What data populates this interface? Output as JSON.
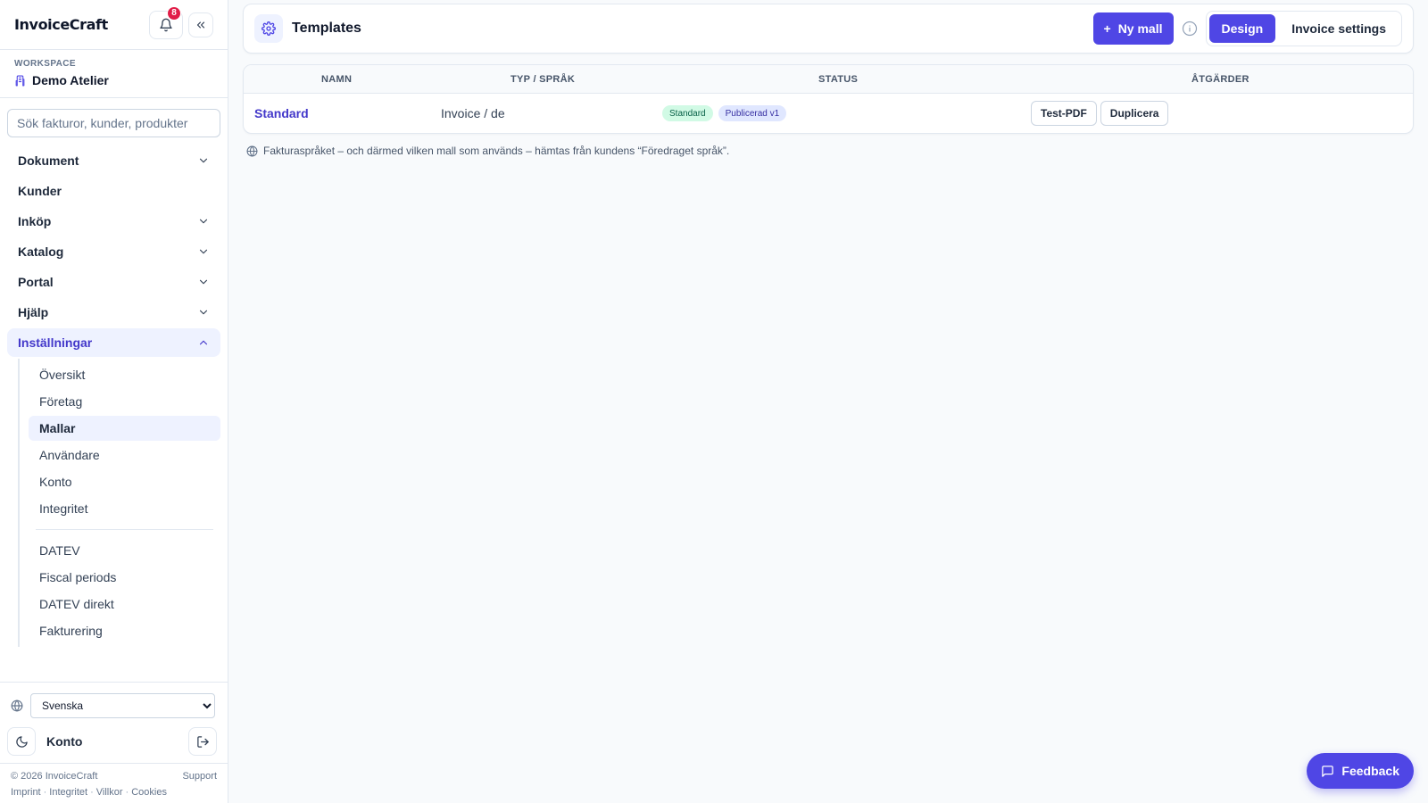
{
  "app": {
    "brand": "InvoiceCraft",
    "notifications_count": "8"
  },
  "workspace": {
    "label": "WORKSPACE",
    "name": "Demo Atelier"
  },
  "search": {
    "placeholder": "Sök fakturor, kunder, produkter"
  },
  "nav": {
    "items": [
      {
        "label": "Dokument",
        "has_children": true
      },
      {
        "label": "Kunder",
        "has_children": false
      },
      {
        "label": "Inköp",
        "has_children": true
      },
      {
        "label": "Katalog",
        "has_children": true
      },
      {
        "label": "Portal",
        "has_children": true
      },
      {
        "label": "Hjälp",
        "has_children": true
      },
      {
        "label": "Inställningar",
        "has_children": true,
        "open": true
      }
    ],
    "settings_sub": [
      {
        "label": "Översikt"
      },
      {
        "label": "Företag"
      },
      {
        "label": "Mallar",
        "active": true
      },
      {
        "label": "Användare"
      },
      {
        "label": "Konto"
      },
      {
        "label": "Integritet"
      }
    ],
    "settings_sub_2": [
      {
        "label": "DATEV"
      },
      {
        "label": "Fiscal periods"
      },
      {
        "label": "DATEV direkt"
      },
      {
        "label": "Fakturering"
      }
    ]
  },
  "sidebar_bottom": {
    "language": "Svenska",
    "account_label": "Konto",
    "footer": {
      "copyright": "© 2026 InvoiceCraft",
      "support": "Support",
      "links": [
        "Imprint",
        "Integritet",
        "Villkor",
        "Cookies"
      ]
    }
  },
  "header": {
    "title": "Templates",
    "new_button": "Ny mall",
    "tabs": [
      {
        "label": "Design",
        "active": true
      },
      {
        "label": "Invoice settings",
        "active": false
      }
    ]
  },
  "table": {
    "columns": [
      "NAMN",
      "TYP / SPRÅK",
      "STATUS",
      "ÅTGÄRDER"
    ],
    "rows": [
      {
        "name": "Standard",
        "type_lang": "Invoice / de",
        "badges": [
          "Standard",
          "Publicerad v1"
        ],
        "actions": [
          "Test-PDF",
          "Duplicera"
        ]
      }
    ]
  },
  "note": "Fakturaspråket – och därmed vilken mall som används – hämtas från kundens “Föredraget språk”.",
  "feedback_label": "Feedback",
  "colors": {
    "accent": "#4f46e5",
    "accent_text": "#4338ca",
    "badge_green": "#d1fae5",
    "badge_indigo": "#e0e7ff",
    "notification": "#e11d48"
  }
}
